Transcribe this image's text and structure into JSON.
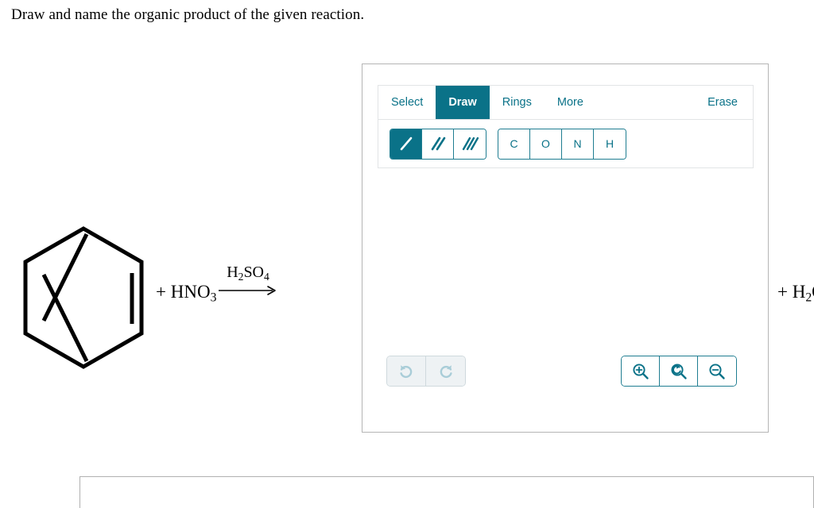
{
  "question": {
    "prompt": "Draw and name the organic product of the given reaction."
  },
  "reaction": {
    "reactant_structure": "benzene-ring",
    "reactant_plus": "+ HNO",
    "reactant_plus_sub": "3",
    "arrow_reagent": "H",
    "arrow_reagent_sub1": "2",
    "arrow_reagent_mid": "SO",
    "arrow_reagent_sub2": "4",
    "arrow": "reaction-arrow-right",
    "product_fragment": "+ H",
    "product_fragment_sub": "2",
    "product_fragment_tail": "O"
  },
  "editor": {
    "tabs": [
      {
        "label": "Select",
        "active": false
      },
      {
        "label": "Draw",
        "active": true
      },
      {
        "label": "Rings",
        "active": false
      },
      {
        "label": "More",
        "active": false
      }
    ],
    "erase_label": "Erase",
    "bond_tools": [
      {
        "name": "single-bond",
        "active": true
      },
      {
        "name": "double-bond",
        "active": false
      },
      {
        "name": "triple-bond",
        "active": false
      }
    ],
    "elements": [
      {
        "label": "C"
      },
      {
        "label": "O"
      },
      {
        "label": "N"
      },
      {
        "label": "H"
      }
    ],
    "history": [
      {
        "name": "undo",
        "enabled": false
      },
      {
        "name": "redo",
        "enabled": false
      }
    ],
    "zoom_controls": [
      {
        "name": "zoom-in"
      },
      {
        "name": "zoom-reset"
      },
      {
        "name": "zoom-out"
      }
    ]
  },
  "colors": {
    "accent": "#0a7288",
    "accent_border": "#1f7d91",
    "panel_border": "#b5b5b5",
    "disabled_bg": "#eef2f4",
    "disabled_icon": "#a9cdd8"
  }
}
